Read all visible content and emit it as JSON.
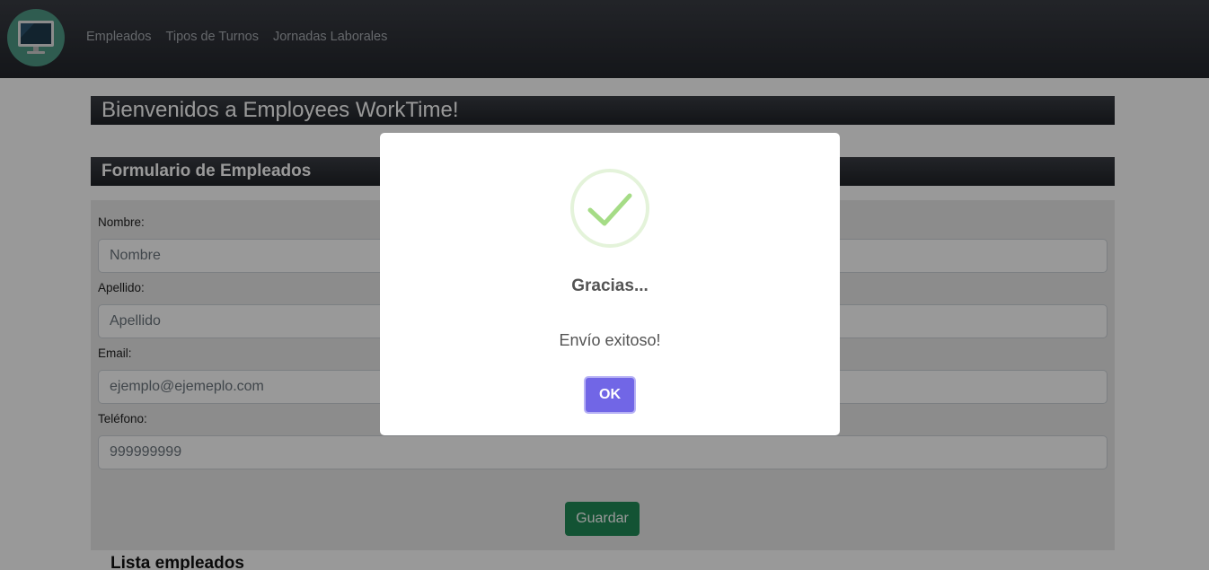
{
  "nav": {
    "logo_icon": "monitor-icon",
    "links": [
      "Empleados",
      "Tipos de Turnos",
      "Jornadas Laborales"
    ]
  },
  "welcome": "Bienvenidos a Employees WorkTime!",
  "form": {
    "title": "Formulario de Empleados",
    "fields": [
      {
        "label": "Nombre:",
        "placeholder": "Nombre"
      },
      {
        "label": "Apellido:",
        "placeholder": "Apellido"
      },
      {
        "label": "Email:",
        "placeholder": "ejemplo@ejemeplo.com"
      },
      {
        "label": "Teléfono:",
        "placeholder": "999999999"
      }
    ],
    "save_label": "Guardar"
  },
  "list_title": "Lista empleados",
  "dialog": {
    "icon": "success-check-icon",
    "title": "Gracias...",
    "text": "Envío exitoso!",
    "ok_label": "OK"
  },
  "colors": {
    "navbar": "#2b2e34",
    "save_button": "#218a57",
    "ok_button": "#7166e6",
    "success": "#a5dc86"
  }
}
